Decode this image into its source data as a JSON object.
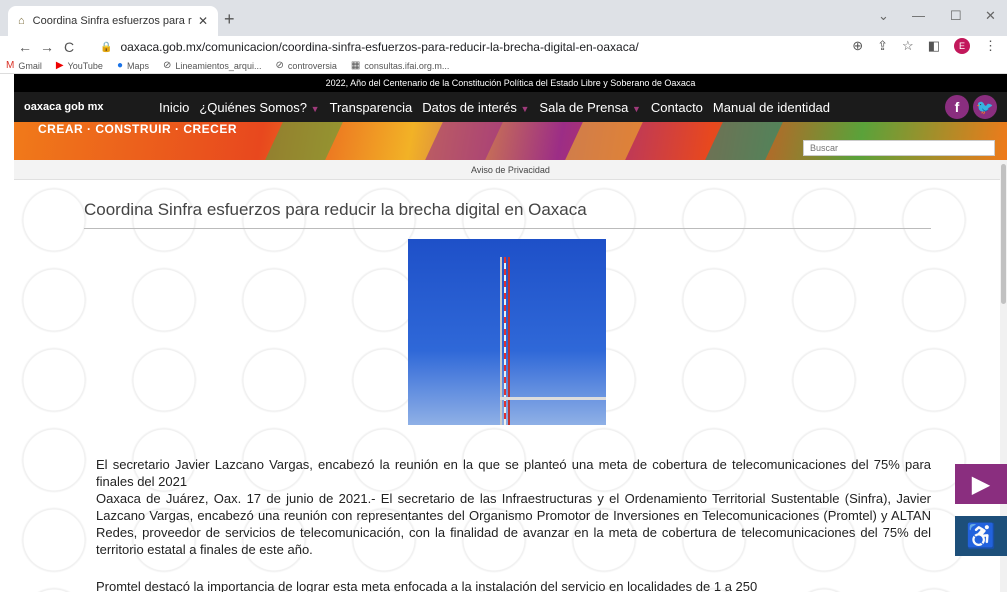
{
  "browser": {
    "tab_title": "Coordina Sinfra esfuerzos para r",
    "tab_close": "✕",
    "new_tab": "+",
    "url": "oaxaca.gob.mx/comunicacion/coordina-sinfra-esfuerzos-para-reducir-la-brecha-digital-en-oaxaca/",
    "profile_initial": "E",
    "bookmarks": [
      {
        "icon": "gmail-icon",
        "label": "Gmail"
      },
      {
        "icon": "youtube-icon",
        "label": "YouTube"
      },
      {
        "icon": "maps-icon",
        "label": "Maps"
      },
      {
        "icon": "link-icon",
        "label": "Lineamientos_arqui..."
      },
      {
        "icon": "link-icon",
        "label": "controversia"
      },
      {
        "icon": "doc-icon",
        "label": "consultas.ifai.org.m..."
      }
    ]
  },
  "site": {
    "announcement": "2022, Año del Centenario de la Constitución Política del Estado Libre y Soberano de Oaxaca",
    "brand": "oaxaca gob mx",
    "menu": [
      "Inicio",
      "¿Quiénes Somos?",
      "Transparencia",
      "Datos de interés",
      "Sala de Prensa",
      "Contacto",
      "Manual de identidad"
    ],
    "banner_slogan": "CREAR · CONSTRUIR · CRECER",
    "search_placeholder": "Buscar",
    "privacy_link": "Aviso de Privacidad"
  },
  "article": {
    "title": "Coordina Sinfra esfuerzos para reducir la brecha digital en Oaxaca",
    "paragraphs": [
      "El secretario Javier Lazcano Vargas, encabezó la reunión en la que se planteó una meta de cobertura de telecomunicaciones del 75% para finales del 2021",
      "Oaxaca de Juárez, Oax. 17 de junio de 2021.- El secretario de las Infraestructuras y el Ordenamiento Territorial Sustentable (Sinfra), Javier Lazcano Vargas, encabezó una reunión con representantes del Organismo Promotor de Inversiones en Telecomunicaciones (Promtel) y ALTAN Redes, proveedor de servicios de telecomunicación, con la finalidad de avanzar en la meta de cobertura de telecomunicaciones del 75% del territorio estatal a finales de este año.",
      "Promtel destacó la importancia de lograr esta meta enfocada a la instalación del servicio en localidades de 1 a 250"
    ]
  },
  "colors": {
    "brand_purple": "#8a2e7f",
    "nav_bg": "#1b1b1b"
  }
}
